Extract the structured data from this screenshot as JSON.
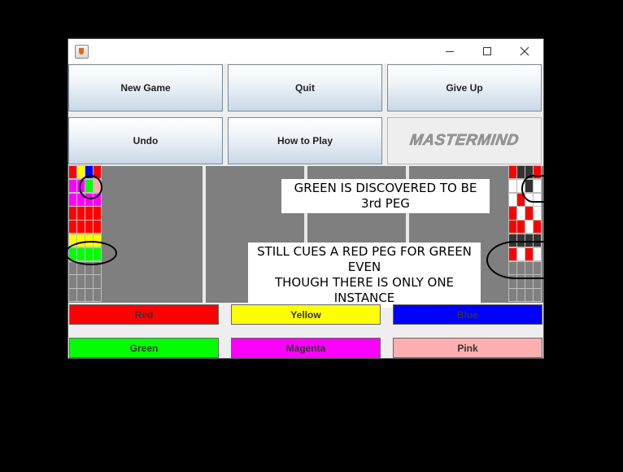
{
  "window": {
    "icon": "java-cup-icon"
  },
  "controls": {
    "minimize_icon": "minimize-icon",
    "maximize_icon": "maximize-icon",
    "close_icon": "close-icon"
  },
  "toolbar": {
    "new_game": "New Game",
    "quit": "Quit",
    "give_up": "Give Up",
    "undo": "Undo",
    "how_to_play": "How to Play",
    "logo": "MASTERMIND"
  },
  "annotations": {
    "top": "GREEN IS DISCOVERED TO BE 3rd PEG",
    "bottom_line1": "STILL CUES A RED PEG FOR GREEN EVEN",
    "bottom_line2": "THOUGH THERE IS ONLY ONE INSTANCE"
  },
  "colors": {
    "red": "#ff0000",
    "yellow": "#ffff00",
    "blue": "#0000ff",
    "green": "#00ff00",
    "magenta": "#ff00ff",
    "pink": "#ffafaf",
    "white": "#ffffff",
    "black": "#333333",
    "empty": "#808080",
    "board": "#7f7f7f"
  },
  "guess_rows": [
    [
      "red",
      "yellow",
      "blue",
      "red"
    ],
    [
      "magenta",
      "magenta",
      "green",
      "pink"
    ],
    [
      "magenta",
      "magenta",
      "magenta",
      "magenta"
    ],
    [
      "red",
      "red",
      "red",
      "red"
    ],
    [
      "red",
      "red",
      "red",
      "red"
    ],
    [
      "yellow",
      "yellow",
      "yellow",
      "yellow"
    ],
    [
      "green",
      "green",
      "green",
      "green"
    ],
    [
      "empty",
      "empty",
      "empty",
      "empty"
    ],
    [
      "empty",
      "empty",
      "empty",
      "empty"
    ],
    [
      "empty",
      "empty",
      "empty",
      "empty"
    ]
  ],
  "cue_rows": [
    [
      "red",
      "black",
      "black",
      "red"
    ],
    [
      "white",
      "white",
      "black",
      "white"
    ],
    [
      "white",
      "red",
      "white",
      "white"
    ],
    [
      "red",
      "white",
      "red",
      "white"
    ],
    [
      "red",
      "red",
      "white",
      "red"
    ],
    [
      "black",
      "black",
      "black",
      "black"
    ],
    [
      "red",
      "white",
      "red",
      "white"
    ],
    [
      "empty",
      "empty",
      "empty",
      "empty"
    ],
    [
      "empty",
      "empty",
      "empty",
      "empty"
    ],
    [
      "empty",
      "empty",
      "empty",
      "empty"
    ]
  ],
  "color_buttons": [
    {
      "label": "Red",
      "color": "#ff0000"
    },
    {
      "label": "Yellow",
      "color": "#ffff00"
    },
    {
      "label": "Blue",
      "color": "#0000ff"
    },
    {
      "label": "Green",
      "color": "#00ff00"
    },
    {
      "label": "Magenta",
      "color": "#ff00ff"
    },
    {
      "label": "Pink",
      "color": "#ffafaf"
    }
  ]
}
